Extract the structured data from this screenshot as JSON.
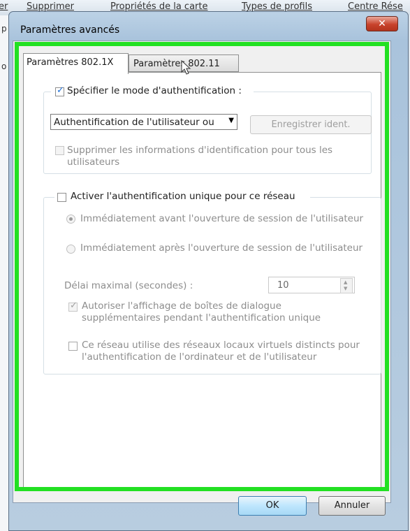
{
  "background": {
    "menu": [
      "Supprimer",
      "Propriétés de la carte",
      "Types de profils",
      "Centre Rése"
    ],
    "left_fragments": [
      "er",
      "p",
      "o"
    ]
  },
  "window": {
    "title": "Paramètres avancés",
    "close_glyph": "✕"
  },
  "tabs": [
    {
      "label": "Paramètres 802.1X",
      "active": true
    },
    {
      "label": "Paramètres 802.11",
      "active": false
    }
  ],
  "auth": {
    "specify_mode": {
      "label": "Spécifier le mode d'authentification :",
      "checked": true,
      "check_glyph": "✓"
    },
    "mode_select": {
      "value": "Authentification de l'utilisateur ou",
      "arrow": "▼"
    },
    "save_credentials_button": "Enregistrer ident.",
    "delete_credentials": {
      "label_line1": "Supprimer les informations d'identification pour tous les",
      "label_line2": "utilisateurs",
      "checked": false
    }
  },
  "sso": {
    "enable": {
      "label": "Activer l'authentification unique pour ce réseau",
      "checked": false
    },
    "radio_before": {
      "label": "Immédiatement avant l'ouverture de session de l'utilisateur",
      "selected": true
    },
    "radio_after": {
      "label": "Immédiatement après l'ouverture de session de l'utilisateur",
      "selected": false
    },
    "max_delay_label": "Délai maximal (secondes) :",
    "max_delay_value": "10",
    "allow_dialogs": {
      "label_line1": "Autoriser l'affichage de boîtes de dialogue",
      "label_line2": "supplémentaires pendant l'authentification unique",
      "checked": true,
      "check_glyph": "✓"
    },
    "vlan": {
      "label_line1": "Ce réseau utilise des réseaux locaux virtuels distincts pour",
      "label_line2": "l'authentification de l'ordinateur et de l'utilisateur",
      "checked": false
    }
  },
  "footer": {
    "ok": "OK",
    "cancel": "Annuler"
  },
  "colors": {
    "highlight": "#22e022",
    "check": "#1c6ed8"
  }
}
